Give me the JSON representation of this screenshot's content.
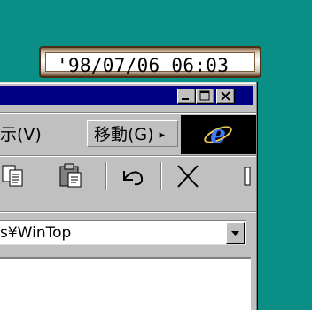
{
  "clock": {
    "text": "'98/07/06 06:03"
  },
  "window": {
    "controls": {
      "minimize_icon": "minimize-icon",
      "maximize_icon": "maximize-icon",
      "close_icon": "close-icon"
    },
    "menu": {
      "view_label": "示(V)",
      "view_underline": "V",
      "go_label": "移動(G)",
      "go_underline": "G",
      "go_arrow": "▸"
    },
    "toolbar": [
      "copy-icon",
      "paste-icon",
      "undo-icon",
      "delete-icon"
    ],
    "address": {
      "value": "s¥WinTop",
      "dropdown_icon": "chevron-down-icon"
    },
    "colors": {
      "title_bar": "#000082",
      "desktop": "#0a8f86",
      "face": "#c0c0c0"
    }
  }
}
